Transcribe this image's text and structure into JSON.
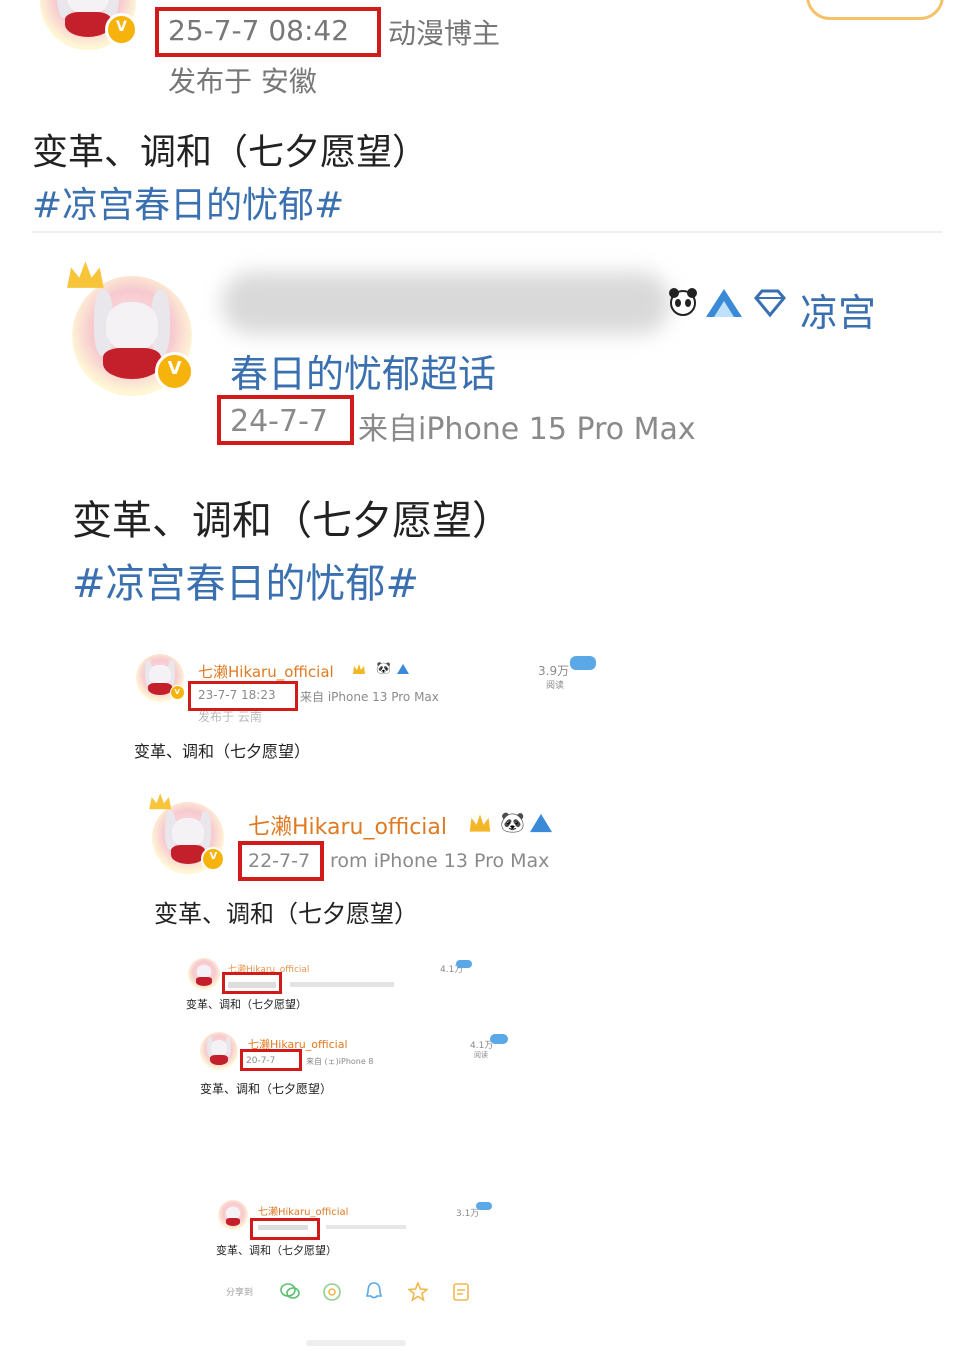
{
  "post1": {
    "date": "25-7-7 08:42",
    "badge": "动漫博主",
    "location": "发布于 安徽",
    "text": "变革、调和（七夕愿望）",
    "hashtag": "#凉宫春日的忧郁#"
  },
  "post2": {
    "name_suffix": "凉宫",
    "supertopic": "春日的忧郁超话",
    "date": "24-7-7",
    "source": "来自iPhone 15 Pro Max",
    "text": "变革、调和（七夕愿望）",
    "hashtag": "#凉宫春日的忧郁#"
  },
  "post3": {
    "name": "七濑Hikaru_official",
    "date": "23-7-7 18:23",
    "source": "来自 iPhone 13 Pro Max",
    "location": "发布于 云南",
    "views": "3.9万",
    "views_label": "阅读",
    "text": "变革、调和（七夕愿望）"
  },
  "post4": {
    "name": "七濑Hikaru_official",
    "date": "22-7-7",
    "source": "rom iPhone 13 Pro Max",
    "text": "变革、调和（七夕愿望）"
  },
  "post5": {
    "name": "七濑Hikaru_official",
    "views": "4.1万",
    "text": "变革、调和（七夕愿望）"
  },
  "post6": {
    "name": "七濑Hikaru_official",
    "date": "20-7-7",
    "source": "来自 (ェ)iPhone 8",
    "views": "4.1万",
    "views_label": "阅读",
    "text": "变革、调和（七夕愿望）"
  },
  "post7": {
    "name": "七濑Hikaru_official",
    "views": "3.1万",
    "text": "变革、调和（七夕愿望）",
    "share_label": "分享到"
  },
  "colors": {
    "highlight_box": "#d11a1a",
    "topic_blue": "#3a6fb0",
    "verified_gold": "#f6b30c"
  },
  "icons": [
    "panda-icon",
    "shark-icon",
    "diamond-icon",
    "crown-icon",
    "wechat-icon",
    "moments-icon",
    "qq-icon",
    "star-icon",
    "copy-icon"
  ]
}
